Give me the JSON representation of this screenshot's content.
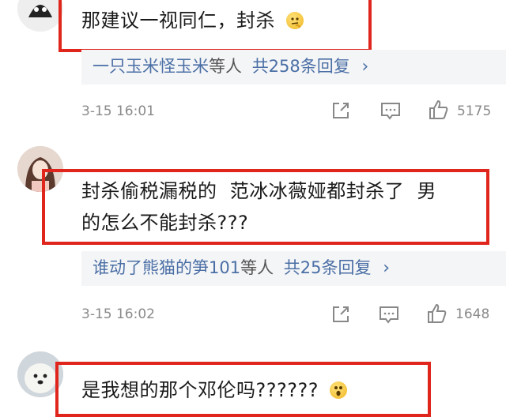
{
  "comments": [
    {
      "text": "那建议一视同仁，封杀",
      "emoji": "thinking-face",
      "reply_users": "一只玉米怪玉米",
      "reply_mid": "等人",
      "reply_count": "共258条回复",
      "reply_chevron": "›",
      "time": "3-15 16:01",
      "likes": "5175"
    },
    {
      "text_line1": "封杀偷税漏税的  范冰冰薇娅都封杀了  男",
      "text_line2": "的怎么不能封杀???",
      "reply_users": "谁动了熊猫的笋101",
      "reply_mid": "等人",
      "reply_count": "共25条回复",
      "reply_chevron": "›",
      "time": "3-15 16:02",
      "likes": "1648"
    },
    {
      "text": "是我想的那个邓伦吗??????",
      "emoji": "surprised-face"
    }
  ]
}
